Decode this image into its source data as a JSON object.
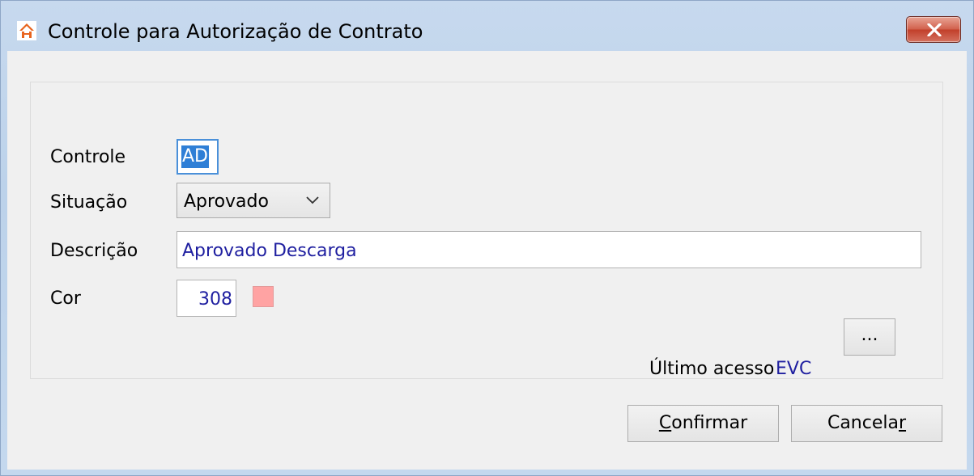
{
  "window": {
    "title": "Controle para Autorização de Contrato"
  },
  "form": {
    "controle_label": "Controle",
    "controle_value": "AD",
    "situacao_label": "Situação",
    "situacao_value": "Aprovado",
    "descricao_label": "Descrição",
    "descricao_value": "Aprovado Descarga",
    "cor_label": "Cor",
    "cor_value": "308",
    "cor_swatch_color": "#ffa3a3",
    "ultimo_acesso_label": "Último acesso",
    "ultimo_acesso_value": "EVC",
    "browse_label": "..."
  },
  "buttons": {
    "confirm_mnemonic": "C",
    "confirm_rest": "onfirmar",
    "cancel_prefix": "Cancela",
    "cancel_mnemonic": "r"
  }
}
